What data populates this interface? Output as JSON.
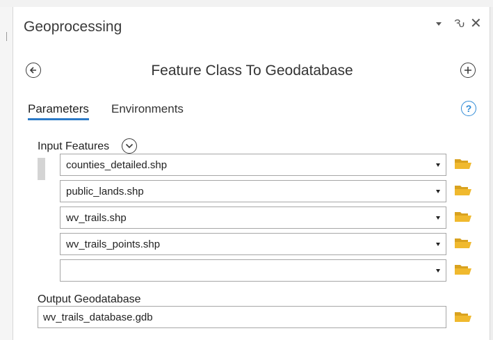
{
  "pane": {
    "title": "Geoprocessing",
    "controls": {
      "menu_icon": "dropdown-arrow",
      "pin_glyph": "Ԅ",
      "close_glyph": "✕"
    }
  },
  "tool": {
    "title": "Feature Class To Geodatabase",
    "back_icon": "back-arrow-circle",
    "add_icon": "plus-circle"
  },
  "tabs": [
    {
      "label": "Parameters",
      "active": true
    },
    {
      "label": "Environments",
      "active": false
    }
  ],
  "help": {
    "glyph": "?"
  },
  "input_features": {
    "label": "Input Features",
    "rows": [
      {
        "value": "counties_detailed.shp"
      },
      {
        "value": "public_lands.shp"
      },
      {
        "value": "wv_trails.shp"
      },
      {
        "value": "wv_trails_points.shp"
      },
      {
        "value": ""
      }
    ]
  },
  "output": {
    "label": "Output Geodatabase",
    "value": "wv_trails_database.gdb"
  },
  "colors": {
    "accent": "#2b7ac7",
    "help": "#2e8ad6",
    "folder": "#f0b92e"
  }
}
